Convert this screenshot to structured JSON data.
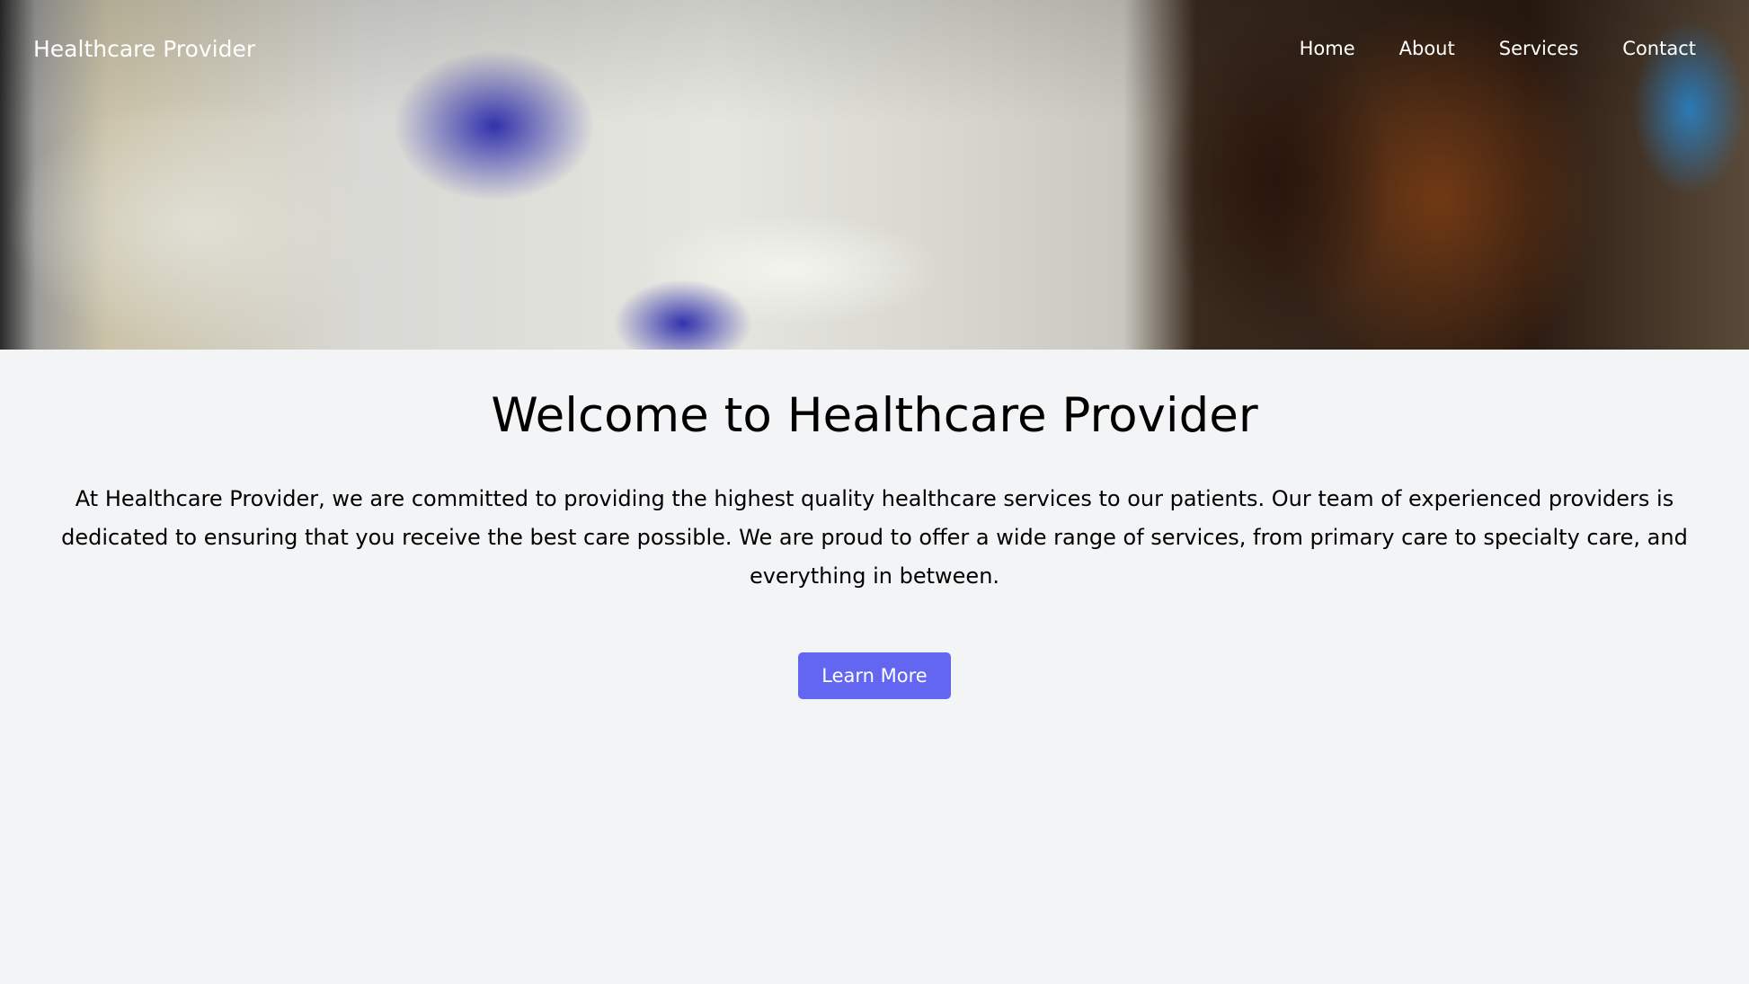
{
  "header": {
    "brand": "Healthcare Provider",
    "nav": [
      {
        "label": "Home"
      },
      {
        "label": "About"
      },
      {
        "label": "Services"
      },
      {
        "label": "Contact"
      }
    ],
    "hero_image": "laboratory-worker-with-test-tubes-photo"
  },
  "main": {
    "title": "Welcome to Healthcare Provider",
    "description": "At Healthcare Provider, we are committed to providing the highest quality healthcare services to our patients. Our team of experienced providers is dedicated to ensuring that you receive the best care possible. We are proud to offer a wide range of services, from primary care to specialty care, and everything in between.",
    "cta_label": "Learn More"
  },
  "colors": {
    "background": "#f3f4f6",
    "accent": "#6366f1"
  }
}
